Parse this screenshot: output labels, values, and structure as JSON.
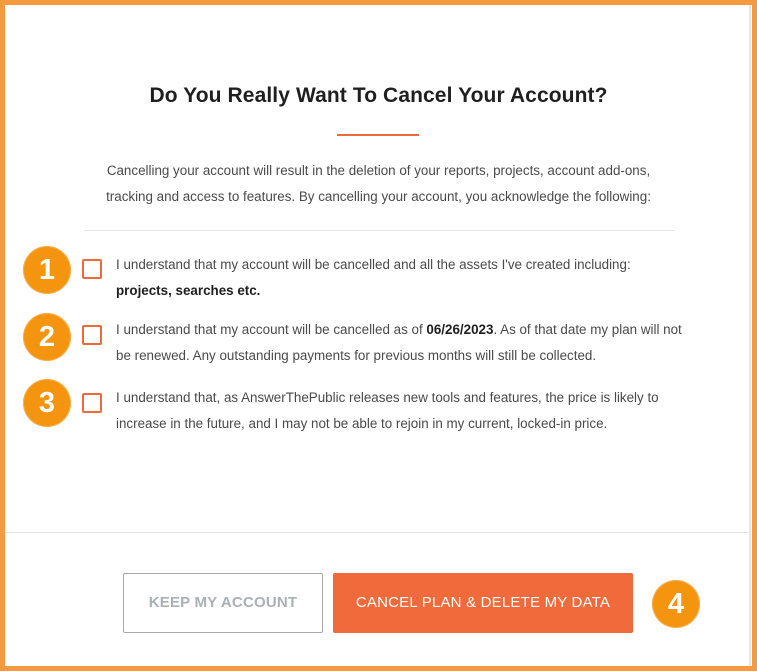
{
  "dialog": {
    "title": "Do You Really Want To Cancel Your Account?",
    "intro_line1": "Cancelling your account will result in the deletion of your reports, projects, account add-ons,",
    "intro_line2": "tracking and access to features. By cancelling your account, you acknowledge the following:"
  },
  "acknowledgements": [
    {
      "badge": "1",
      "checked": false,
      "text_before": "I understand that my account will be cancelled and all the assets I've created including:",
      "bold": "projects, searches etc.",
      "text_after": ""
    },
    {
      "badge": "2",
      "checked": false,
      "text_before": "I understand that my account will be cancelled as of",
      "bold": "06/26/2023",
      "text_after": ". As of that date my plan will not be renewed. Any outstanding payments for previous months will still be collected."
    },
    {
      "badge": "3",
      "checked": false,
      "text_before": "I understand that, as AnswerThePublic releases new tools and features, the price is likely to increase in the future, and I may not be able to rejoin in my current, locked-in price.",
      "bold": "",
      "text_after": ""
    }
  ],
  "footer": {
    "keep_label": "KEEP MY ACCOUNT",
    "cancel_label": "CANCEL PLAN & DELETE MY DATA",
    "cancel_badge": "4"
  },
  "colors": {
    "frame": "#f59a3e",
    "accent": "#ee6a3a",
    "badge": "#f5950f",
    "keep_text": "#a9b1b5"
  }
}
